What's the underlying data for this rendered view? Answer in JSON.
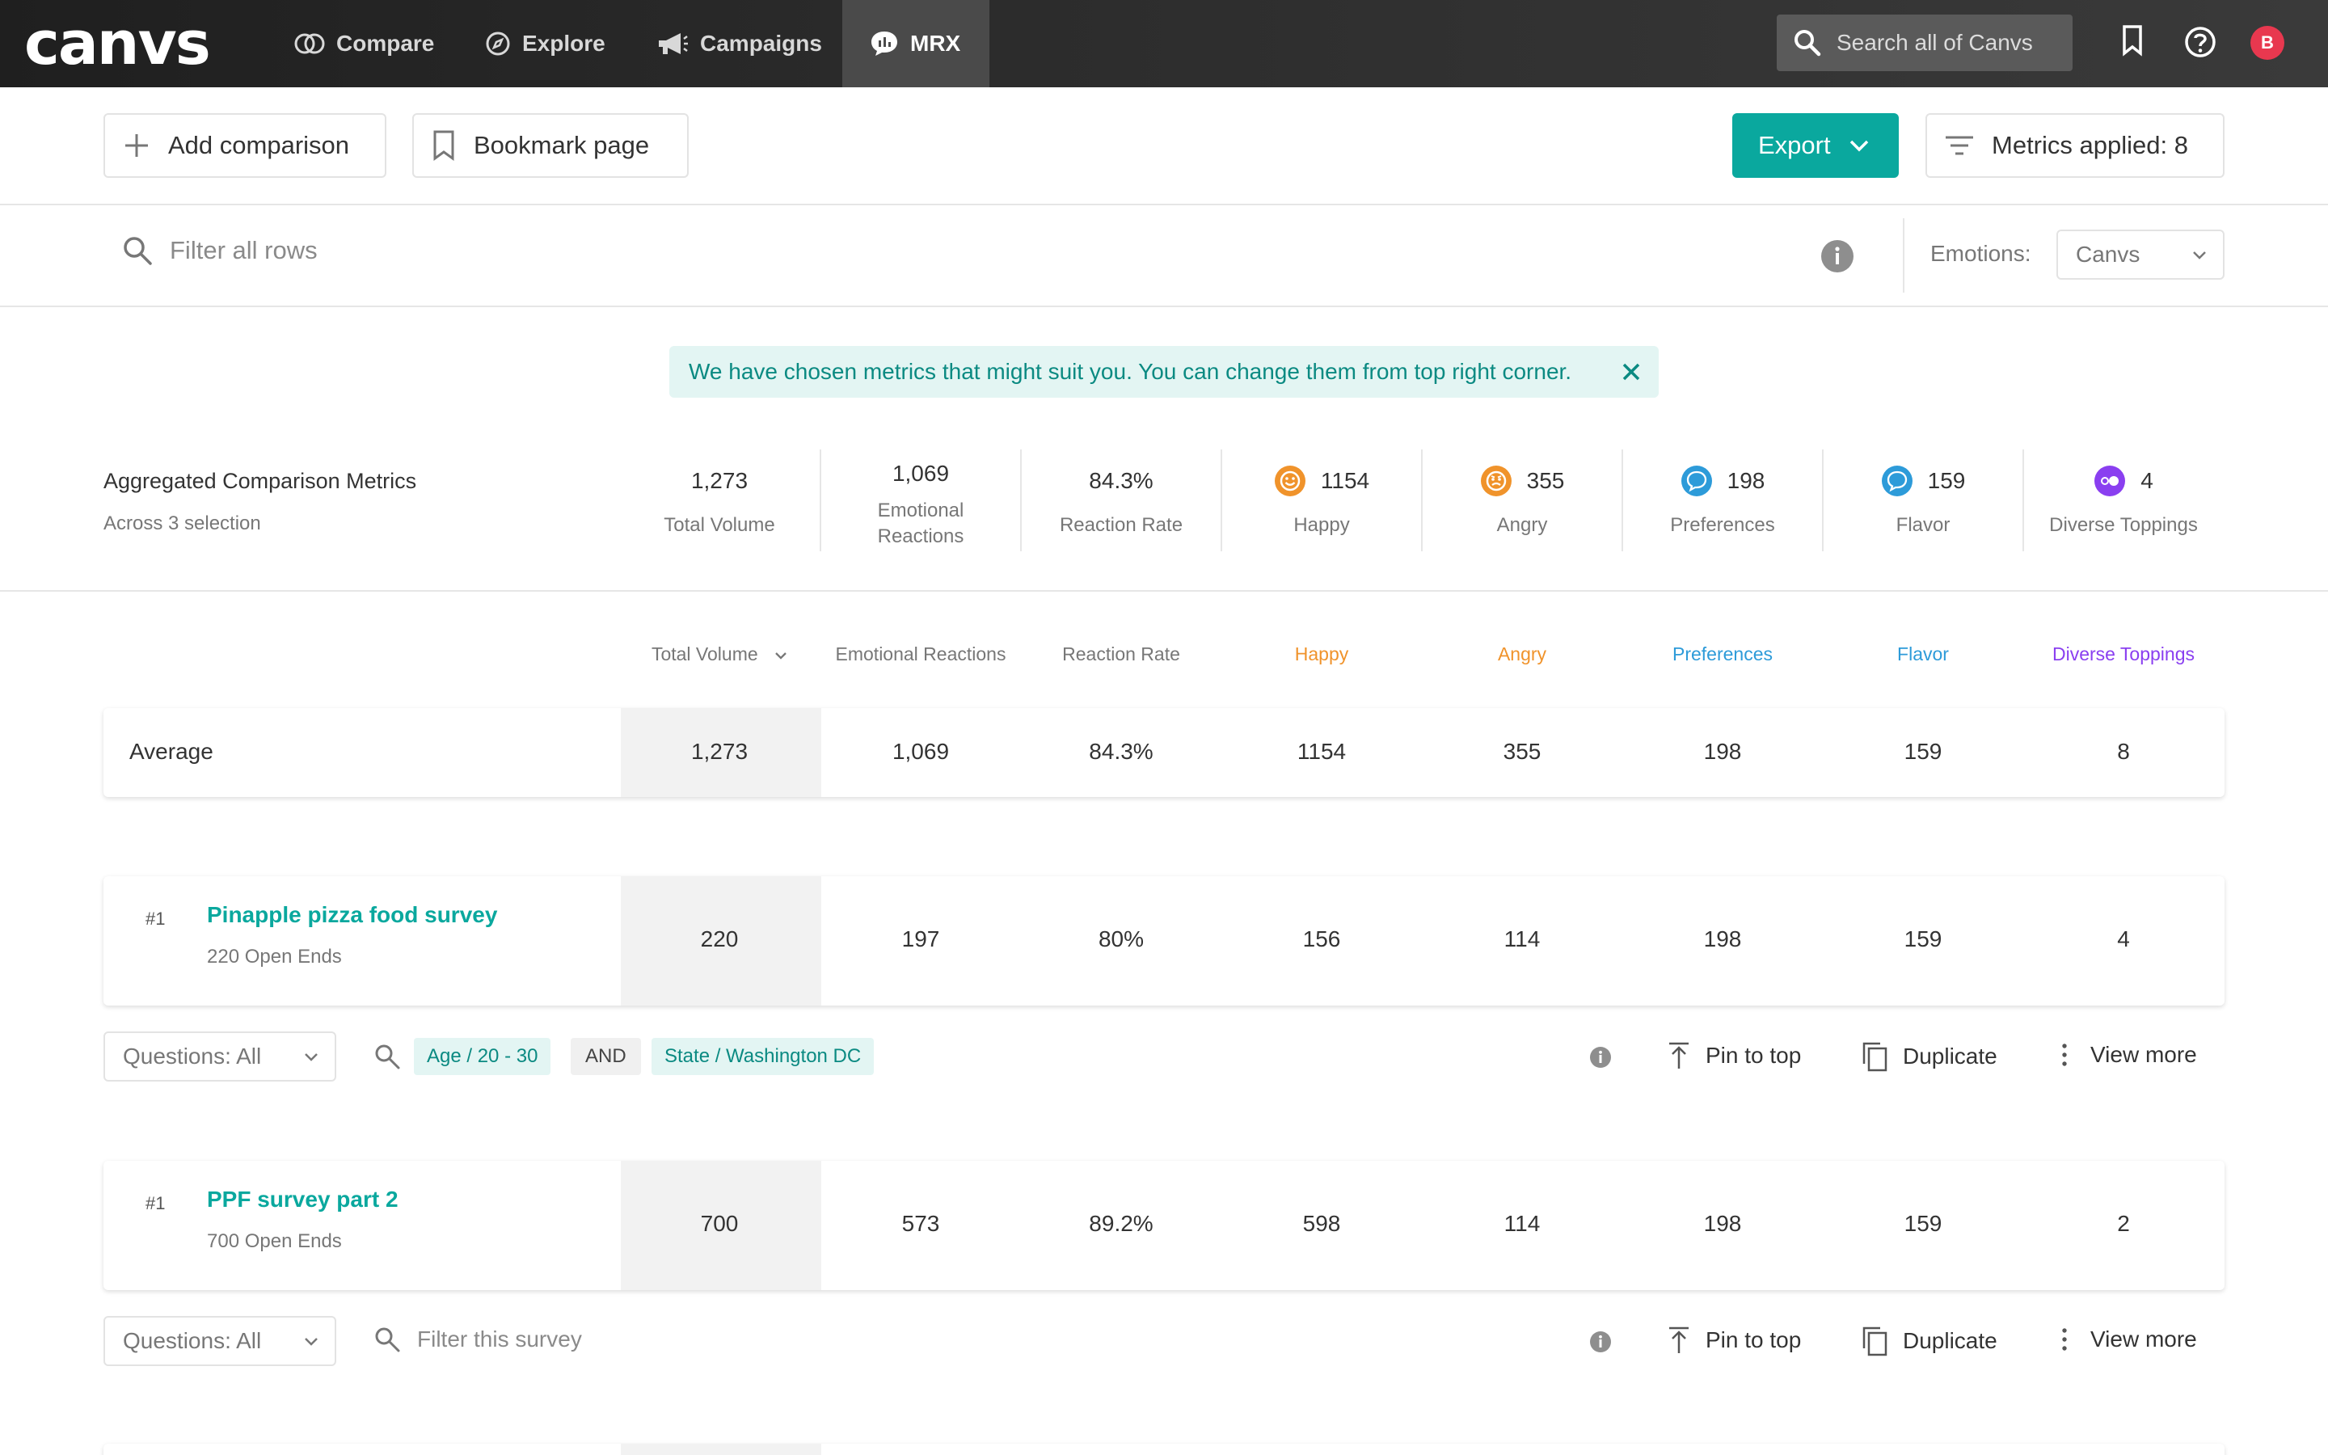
{
  "app": {
    "logo": "canvs"
  },
  "nav": {
    "items": [
      {
        "label": "Compare",
        "icon": "compare-icon"
      },
      {
        "label": "Explore",
        "icon": "compass-icon"
      },
      {
        "label": "Campaigns",
        "icon": "megaphone-icon"
      },
      {
        "label": "MRX",
        "icon": "chat-chart-icon",
        "active": true
      }
    ],
    "search_placeholder": "Search all of Canvs",
    "avatar_initial": "B"
  },
  "toolbar": {
    "add_comparison": "Add comparison",
    "bookmark_page": "Bookmark page",
    "export": "Export",
    "metrics_applied": "Metrics applied: 8"
  },
  "filter": {
    "placeholder": "Filter all rows",
    "emotions_label": "Emotions:",
    "emotions_value": "Canvs"
  },
  "notice": {
    "text": "We have chosen metrics that might suit you. You can change them from top right corner."
  },
  "aggregated": {
    "title": "Aggregated Comparison Metrics",
    "subtitle": "Across 3 selection",
    "metrics": [
      {
        "value": "1,273",
        "label": "Total Volume"
      },
      {
        "value": "1,069",
        "label": "Emotional Reactions"
      },
      {
        "value": "84.3%",
        "label": "Reaction Rate"
      },
      {
        "value": "1154",
        "label": "Happy"
      },
      {
        "value": "355",
        "label": "Angry"
      },
      {
        "value": "198",
        "label": "Preferences"
      },
      {
        "value": "159",
        "label": "Flavor"
      },
      {
        "value": "4",
        "label": "Diverse Toppings"
      }
    ]
  },
  "columns": [
    {
      "label": "Total Volume",
      "color": "#777777",
      "sorted": true
    },
    {
      "label": "Emotional Reactions",
      "color": "#777777"
    },
    {
      "label": "Reaction Rate",
      "color": "#777777"
    },
    {
      "label": "Happy",
      "color": "#f0932b"
    },
    {
      "label": "Angry",
      "color": "#f0932b"
    },
    {
      "label": "Preferences",
      "color": "#2d9bd9"
    },
    {
      "label": "Flavor",
      "color": "#2d9bd9"
    },
    {
      "label": "Diverse Toppings",
      "color": "#8a3ff0"
    }
  ],
  "colors": {
    "accent": "#0aa89e",
    "happy": "#f0932b",
    "angry": "#f0932b",
    "preferences": "#2d9bd9",
    "flavor": "#2d9bd9",
    "diverse": "#8a3ff0"
  },
  "average": {
    "label": "Average",
    "values": [
      "1,273",
      "1,069",
      "84.3%",
      "1154",
      "355",
      "198",
      "159",
      "8"
    ]
  },
  "surveys": [
    {
      "rank": "#1",
      "title": "Pinapple pizza food survey",
      "subtitle": "220 Open Ends",
      "values": [
        "220",
        "197",
        "80%",
        "156",
        "114",
        "198",
        "159",
        "4"
      ],
      "questions": "Questions: All",
      "tags": [
        "Age / 20 - 30",
        "AND",
        "State / Washington DC"
      ],
      "pin": "Pin to top",
      "duplicate": "Duplicate",
      "view_more": "View more"
    },
    {
      "rank": "#1",
      "title": "PPF survey part 2",
      "subtitle": "700 Open Ends",
      "values": [
        "700",
        "573",
        "89.2%",
        "598",
        "114",
        "198",
        "159",
        "2"
      ],
      "questions": "Questions: All",
      "filter_placeholder": "Filter this survey",
      "pin": "Pin to top",
      "duplicate": "Duplicate",
      "view_more": "View more"
    }
  ]
}
